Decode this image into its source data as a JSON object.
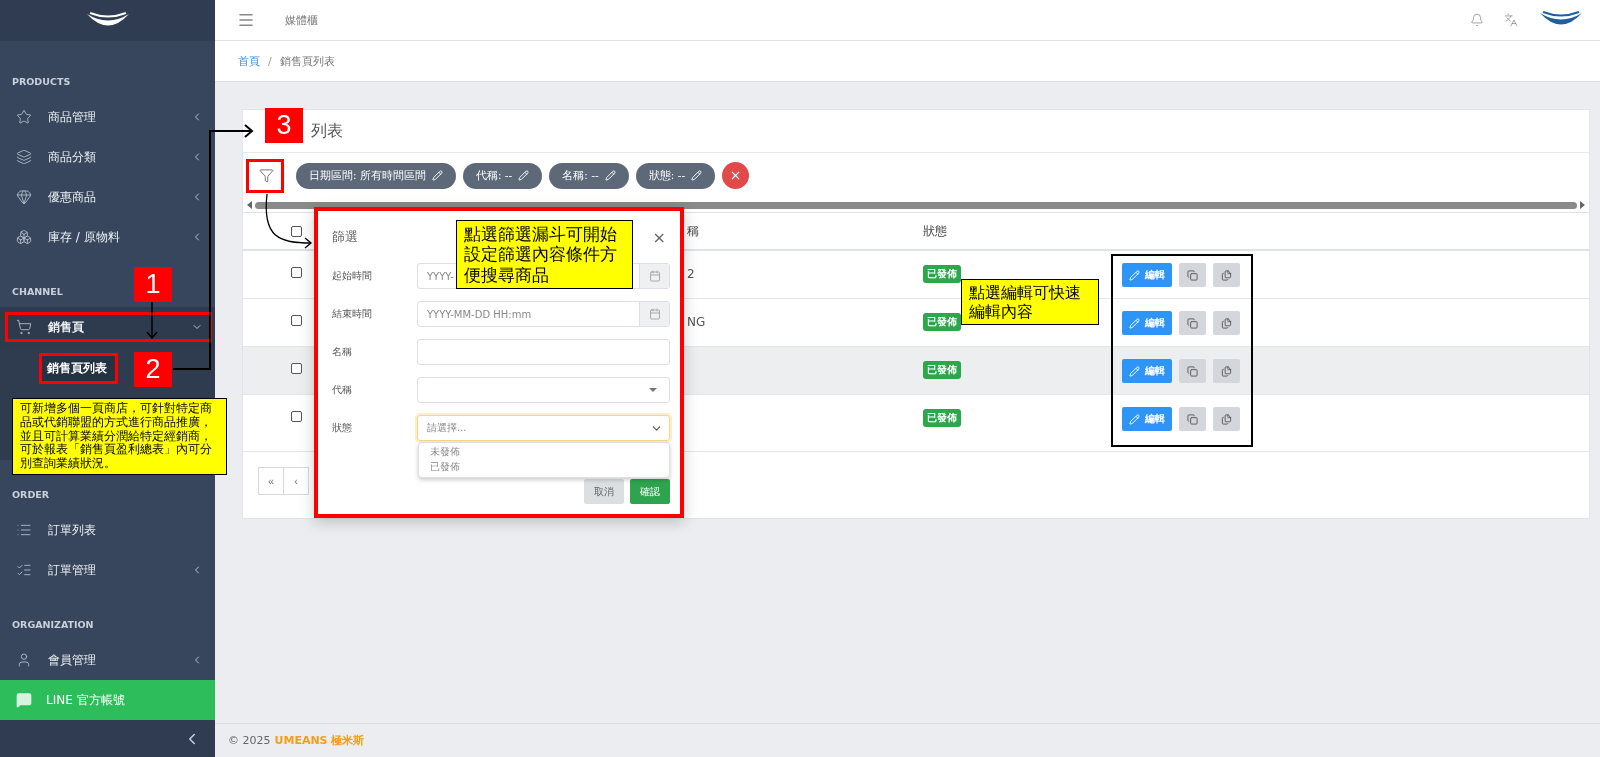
{
  "sidebar": {
    "sections": [
      {
        "title": "PRODUCTS",
        "items": [
          {
            "label": "商品管理",
            "expandable": true,
            "expanded": false,
            "selected": false
          },
          {
            "label": "商品分類",
            "expandable": true,
            "expanded": false,
            "selected": false
          },
          {
            "label": "優惠商品",
            "expandable": true,
            "expanded": false,
            "selected": false
          },
          {
            "label": "庫存 / 原物料",
            "expandable": true,
            "expanded": false,
            "selected": false
          }
        ]
      },
      {
        "title": "CHANNEL",
        "items": [
          {
            "label": "銷售頁",
            "expandable": true,
            "expanded": true,
            "selected": true,
            "children": [
              {
                "label": "銷售頁列表",
                "selected": true
              }
            ]
          }
        ]
      },
      {
        "title": "ORDER",
        "items": [
          {
            "label": "訂單列表",
            "expandable": false,
            "selected": false
          },
          {
            "label": "訂單管理",
            "expandable": true,
            "expanded": false,
            "selected": false
          }
        ]
      },
      {
        "title": "ORGANIZATION",
        "items": [
          {
            "label": "會員管理",
            "expandable": true,
            "expanded": false,
            "selected": false
          }
        ]
      }
    ],
    "line_link": {
      "label": "LINE 官方帳號"
    }
  },
  "header": {
    "title": "媒體櫃"
  },
  "breadcrumb": [
    {
      "label": "首頁",
      "link": true
    },
    {
      "label": "銷售頁列表",
      "link": false
    }
  ],
  "breadcrumb_separator": "/",
  "card": {
    "title": "列表",
    "filters": [
      {
        "label": "日期區間: 所有時間區間"
      },
      {
        "label": "代稱: --"
      },
      {
        "label": "名稱: --"
      },
      {
        "label": "狀態: --"
      }
    ],
    "table": {
      "columns": [
        "稱",
        "狀態"
      ],
      "select_all_checked": false,
      "rows": [
        {
          "checked": false,
          "highlighted": false,
          "column_2": "2",
          "status": "已發佈",
          "action": "編輯"
        },
        {
          "checked": false,
          "highlighted": false,
          "column_2": "NG",
          "status": "已發佈",
          "action": "編輯"
        },
        {
          "checked": false,
          "highlighted": true,
          "status": "已發佈",
          "action": "編輯"
        },
        {
          "checked": false,
          "highlighted": false,
          "status": "已發佈",
          "action": "編輯"
        }
      ]
    },
    "pagination": [
      "«",
      "‹"
    ]
  },
  "modal": {
    "title": "篩選",
    "close": "×",
    "fields": [
      {
        "label": "起始時間",
        "kind": "date",
        "placeholder": "YYYY-"
      },
      {
        "label": "結束時間",
        "kind": "date",
        "placeholder": "YYYY-MM-DD HH:mm"
      },
      {
        "label": "名稱",
        "kind": "text"
      },
      {
        "label": "代稱",
        "kind": "select",
        "focused": false
      },
      {
        "label": "狀態",
        "kind": "select",
        "focused": true,
        "placeholder": "請選擇...",
        "expanded": true,
        "options": [
          "未發佈",
          "已發佈"
        ]
      }
    ],
    "buttons": [
      {
        "label": "取消",
        "kind": "secondary"
      },
      {
        "label": "確認",
        "kind": "primary"
      }
    ]
  },
  "annotations": {
    "badges": [
      "1",
      "2",
      "3"
    ],
    "notes": [
      "可新增多個一頁商店，可針對特定商品或代銷聯盟的方式進行商品推廣，並且可計算業績分潤給特定經銷商，可於報表「銷售頁盈利總表」內可分別查詢業績狀況。",
      "點選篩選漏斗可開始設定篩選內容條件方便搜尋商品",
      "點選編輯可快速編輯內容"
    ]
  },
  "footer": {
    "copyright": "© 2025",
    "brand": "UMEANS 極米斯"
  }
}
